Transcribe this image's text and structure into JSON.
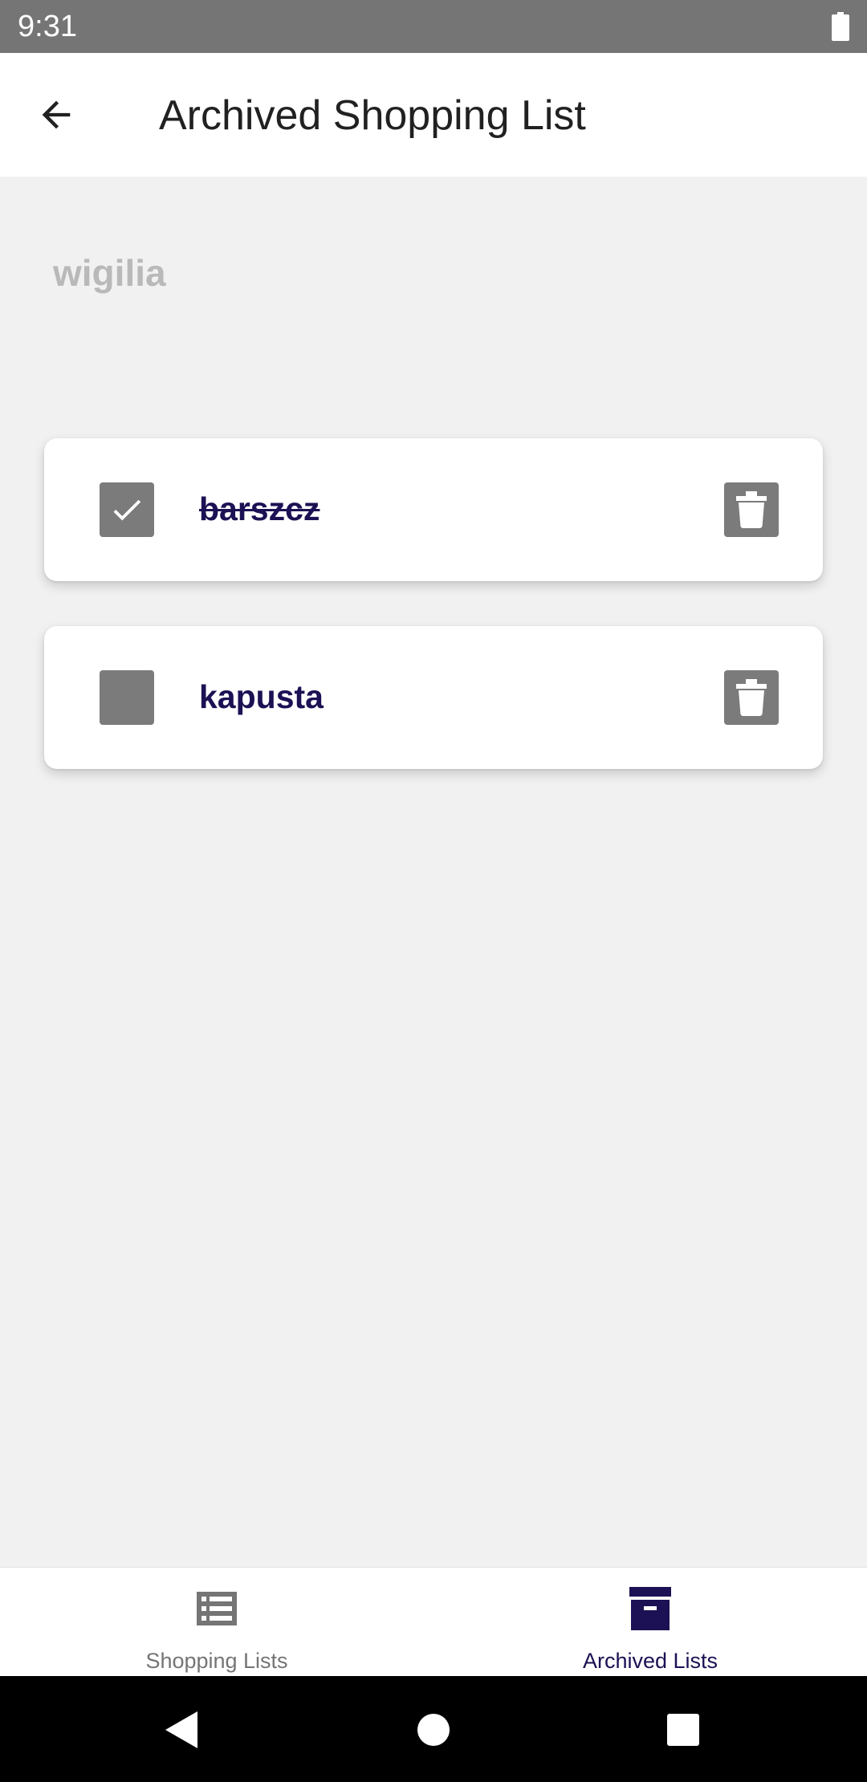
{
  "status_bar": {
    "time": "9:31"
  },
  "app_bar": {
    "title": "Archived Shopping List"
  },
  "list": {
    "name": "wigilia",
    "items": [
      {
        "name": "barszcz",
        "checked": true
      },
      {
        "name": "kapusta",
        "checked": false
      }
    ]
  },
  "bottom_nav": {
    "items": [
      {
        "label": "Shopping Lists",
        "icon": "list-icon",
        "active": false
      },
      {
        "label": "Archived Lists",
        "icon": "archive-icon",
        "active": true
      }
    ]
  },
  "colors": {
    "accent": "#1c1154",
    "inactive": "#757575",
    "muted_title": "#b9b9b9",
    "control_gray": "#7b7b7b"
  }
}
